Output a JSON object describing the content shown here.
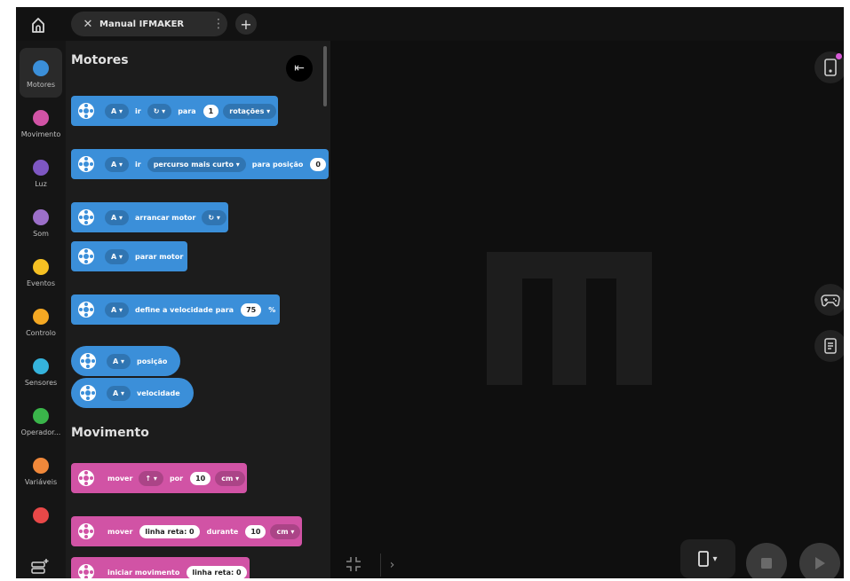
{
  "topbar": {
    "tab_title": "Manual IFMAKER",
    "close_glyph": "✕",
    "menu_glyph": "⋮",
    "add_glyph": "+"
  },
  "categories": [
    {
      "label": "Motores",
      "color": "#3b8fd9"
    },
    {
      "label": "Movimento",
      "color": "#d153a5"
    },
    {
      "label": "Luz",
      "color": "#7e57c2"
    },
    {
      "label": "Som",
      "color": "#9c6fc9"
    },
    {
      "label": "Eventos",
      "color": "#f5c023"
    },
    {
      "label": "Controlo",
      "color": "#f4a823"
    },
    {
      "label": "Sensores",
      "color": "#35b3dc"
    },
    {
      "label": "Operador...",
      "color": "#3ab54a"
    },
    {
      "label": "Variáveis",
      "color": "#f0883a"
    },
    {
      "label": "",
      "color": "#e84848"
    }
  ],
  "palette": {
    "collapse_glyph": "⇤",
    "section_motores": "Motores",
    "section_movimento": "Movimento",
    "blocks": {
      "b1": {
        "port": "A ▾",
        "t1": "ir",
        "dir": "↻ ▾",
        "t2": "para",
        "value": "1",
        "unit": "rotações ▾"
      },
      "b2": {
        "port": "A ▾",
        "t1": "ir",
        "path": "percurso mais curto ▾",
        "t2": "para posição",
        "value": "0"
      },
      "b3": {
        "port": "A ▾",
        "t1": "arrancar motor",
        "dir": "↻ ▾"
      },
      "b4": {
        "port": "A ▾",
        "t1": "parar motor"
      },
      "b5": {
        "port": "A ▾",
        "t1": "define a velocidade para",
        "value": "75",
        "unit": "%"
      },
      "b6": {
        "port": "A ▾",
        "t1": "posição"
      },
      "b7": {
        "port": "A ▾",
        "t1": "velocidade"
      },
      "b8": {
        "t1": "mover",
        "dir": "↑ ▾",
        "t2": "por",
        "value": "10",
        "unit": "cm ▾"
      },
      "b9": {
        "t1": "mover",
        "mode": "linha reta: 0",
        "t2": "durante",
        "value": "10",
        "unit": "cm ▾"
      },
      "b10": {
        "t1": "iniciar movimento",
        "mode": "linha reta: 0"
      }
    }
  },
  "canvas": {
    "device_caret": "▾",
    "expand_glyph": "›"
  },
  "colors": {
    "motor_block": "#3b8fd9",
    "movement_block": "#d153a5",
    "background": "#0f0f0f",
    "hub_indicator": "#d65ad6"
  }
}
